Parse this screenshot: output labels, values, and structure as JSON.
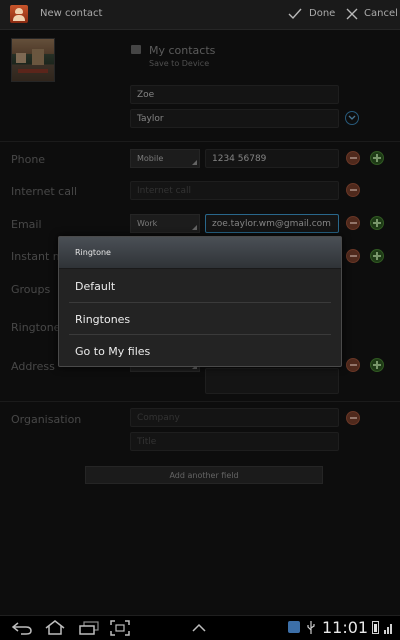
{
  "actionbar": {
    "title": "New contact",
    "done_label": "Done",
    "cancel_label": "Cancel"
  },
  "account": {
    "name": "My contacts",
    "subtitle": "Save to Device"
  },
  "name": {
    "first": "Zoe",
    "last": "Taylor"
  },
  "phone": {
    "label": "Phone",
    "type": "Mobile",
    "value": "1234 56789"
  },
  "internet_call": {
    "label": "Internet call",
    "placeholder": "Internet call"
  },
  "email": {
    "label": "Email",
    "type": "Work",
    "value": "zoe.taylor.wm@gmail.com"
  },
  "instant_message": {
    "label": "Instant m"
  },
  "groups": {
    "label": "Groups"
  },
  "ringtone": {
    "label": "Ringtone"
  },
  "address": {
    "label": "Address"
  },
  "organisation": {
    "label": "Organisation",
    "company_placeholder": "Company",
    "title_placeholder": "Title"
  },
  "add_field_label": "Add another field",
  "dialog": {
    "title": "Ringtone",
    "options": [
      "Default",
      "Ringtones",
      "Go to My files"
    ]
  },
  "statusbar": {
    "time": "11:01"
  },
  "colors": {
    "focus": "#3f9ed6",
    "remove": "#a0533a",
    "add": "#4a8a34"
  }
}
